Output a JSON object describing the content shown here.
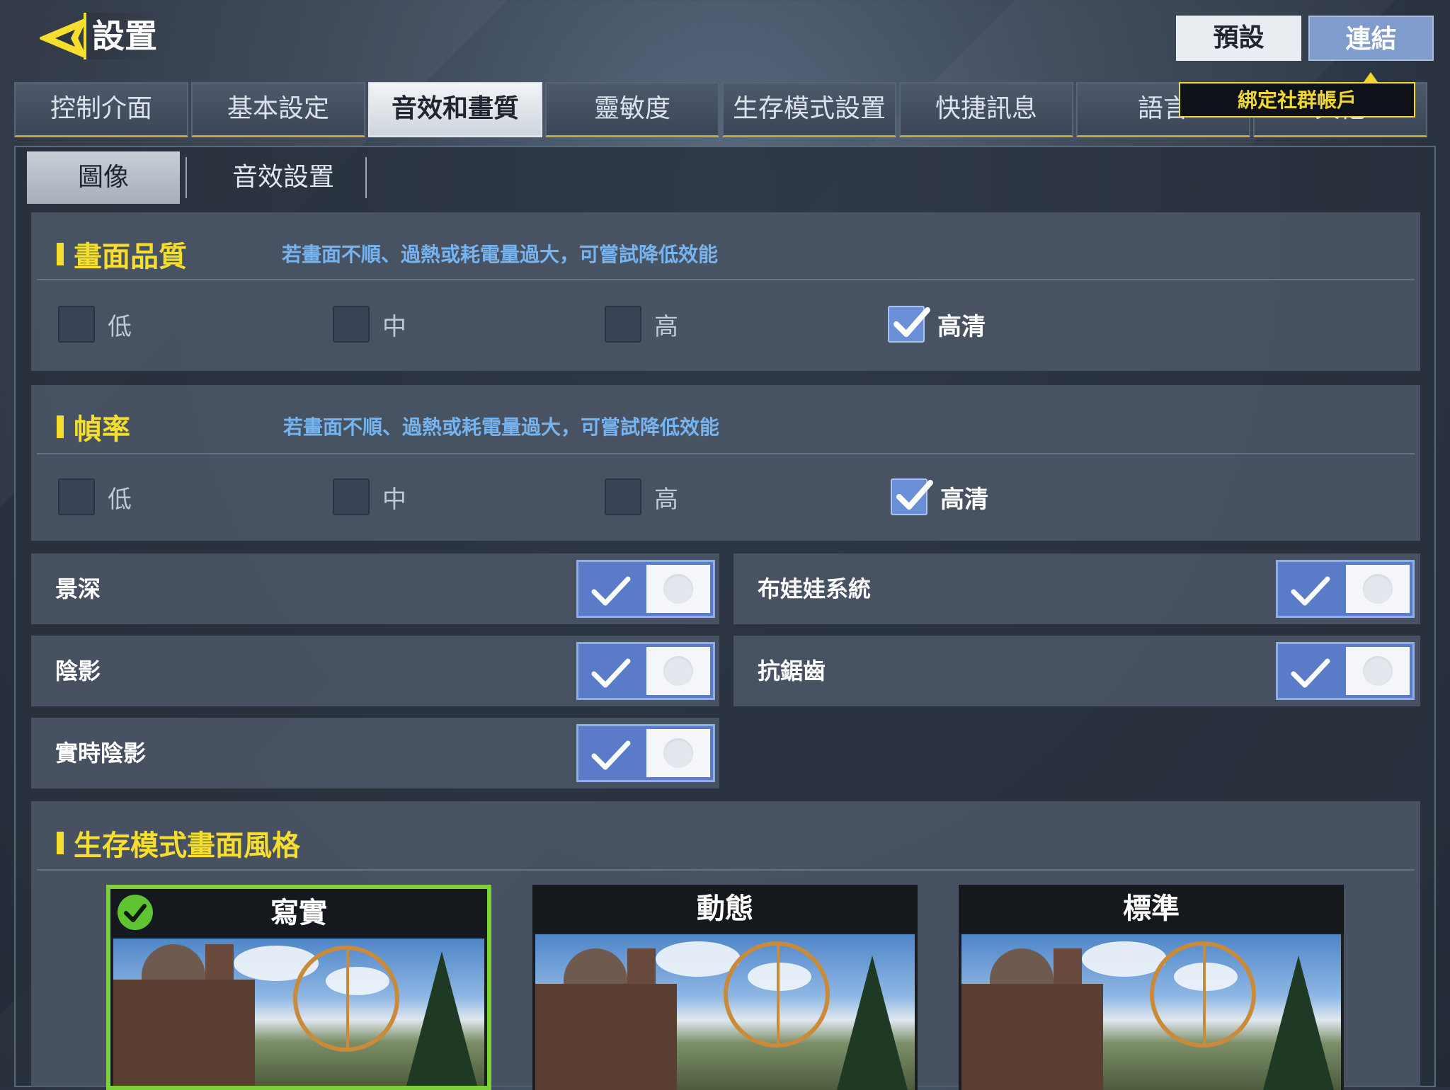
{
  "header": {
    "title": "設置",
    "preset_label": "預設",
    "link_label": "連結",
    "link_tooltip": "綁定社群帳戶"
  },
  "tabs": [
    {
      "label": "控制介面",
      "active": false
    },
    {
      "label": "基本設定",
      "active": false
    },
    {
      "label": "音效和畫質",
      "active": true
    },
    {
      "label": "靈敏度",
      "active": false
    },
    {
      "label": "生存模式設置",
      "active": false
    },
    {
      "label": "快捷訊息",
      "active": false
    },
    {
      "label": "語言",
      "active": false
    },
    {
      "label": "其他",
      "active": false
    }
  ],
  "subtabs": [
    {
      "label": "圖像",
      "active": true
    },
    {
      "label": "音效設置",
      "active": false
    }
  ],
  "quality": {
    "title": "畫面品質",
    "hint": "若畫面不順、過熱或耗電量過大，可嘗試降低效能",
    "options": [
      "低",
      "中",
      "高",
      "高清"
    ],
    "selected": "高清"
  },
  "framerate": {
    "title": "幀率",
    "hint": "若畫面不順、過熱或耗電量過大，可嘗試降低效能",
    "options": [
      "低",
      "中",
      "高",
      "高清"
    ],
    "selected": "高清"
  },
  "toggles": [
    {
      "label": "景深",
      "on": true
    },
    {
      "label": "布娃娃系統",
      "on": true
    },
    {
      "label": "陰影",
      "on": true
    },
    {
      "label": "抗鋸齒",
      "on": true
    },
    {
      "label": "實時陰影",
      "on": true
    }
  ],
  "style": {
    "title": "生存模式畫面風格",
    "cards": [
      {
        "label": "寫實",
        "selected": true
      },
      {
        "label": "動態",
        "selected": false
      },
      {
        "label": "標準",
        "selected": false
      }
    ]
  },
  "colors": {
    "accent_yellow": "#f5de2e",
    "hint_blue": "#75b4f0",
    "toggle_blue": "#5a7cc8",
    "selected_green": "#7ed03a"
  },
  "icons": {
    "back": "back-arrow-icon",
    "check": "checkmark-icon"
  }
}
